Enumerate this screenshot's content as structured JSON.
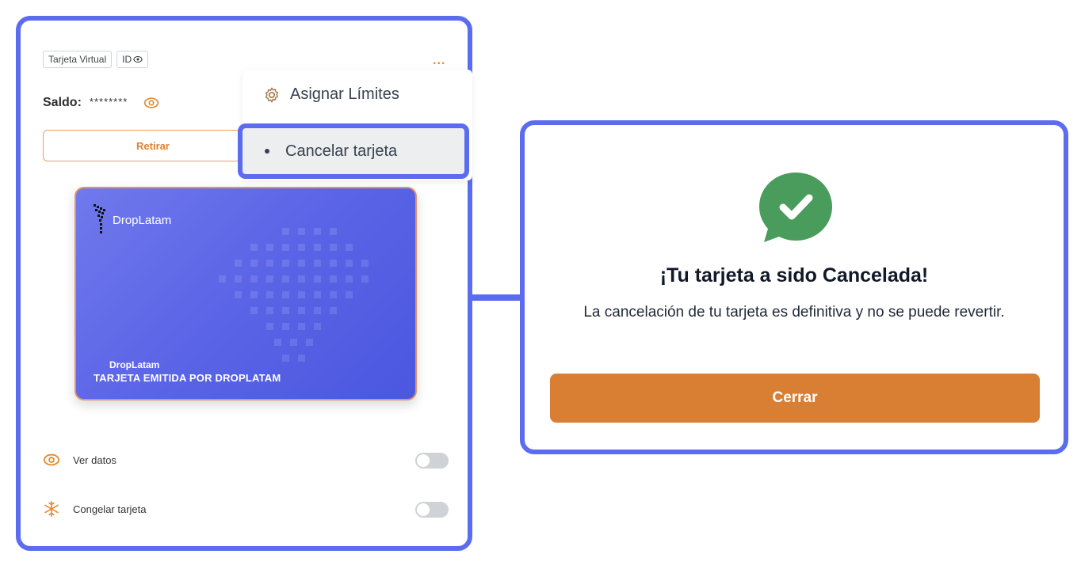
{
  "card_panel": {
    "tags": {
      "virtual": "Tarjeta Virtual",
      "id": "ID"
    },
    "more_menu": "...",
    "balance": {
      "label": "Saldo:",
      "value": "********"
    },
    "withdraw_label": "Retirar",
    "dropdown": {
      "item_limits": "Asignar Límites",
      "item_cancel": "Cancelar tarjeta"
    },
    "card": {
      "brand": "DropLatam",
      "holder": "DropLatam",
      "issuer": "TARJETA EMITIDA POR DROPLATAM"
    },
    "options": [
      {
        "label": "Ver datos",
        "icon": "eye-icon",
        "enabled": false
      },
      {
        "label": "Congelar tarjeta",
        "icon": "snowflake-icon",
        "enabled": false
      }
    ]
  },
  "modal": {
    "title": "¡Tu tarjeta a sido Cancelada!",
    "message": "La cancelación de tu tarjeta es definitiva y no se puede revertir.",
    "close_label": "Cerrar",
    "icon": "check-chat-icon"
  },
  "colors": {
    "accent": "#5b6cf0",
    "orange": "#d87f34",
    "success": "#4a9c5c",
    "card": "#5a64e6"
  }
}
